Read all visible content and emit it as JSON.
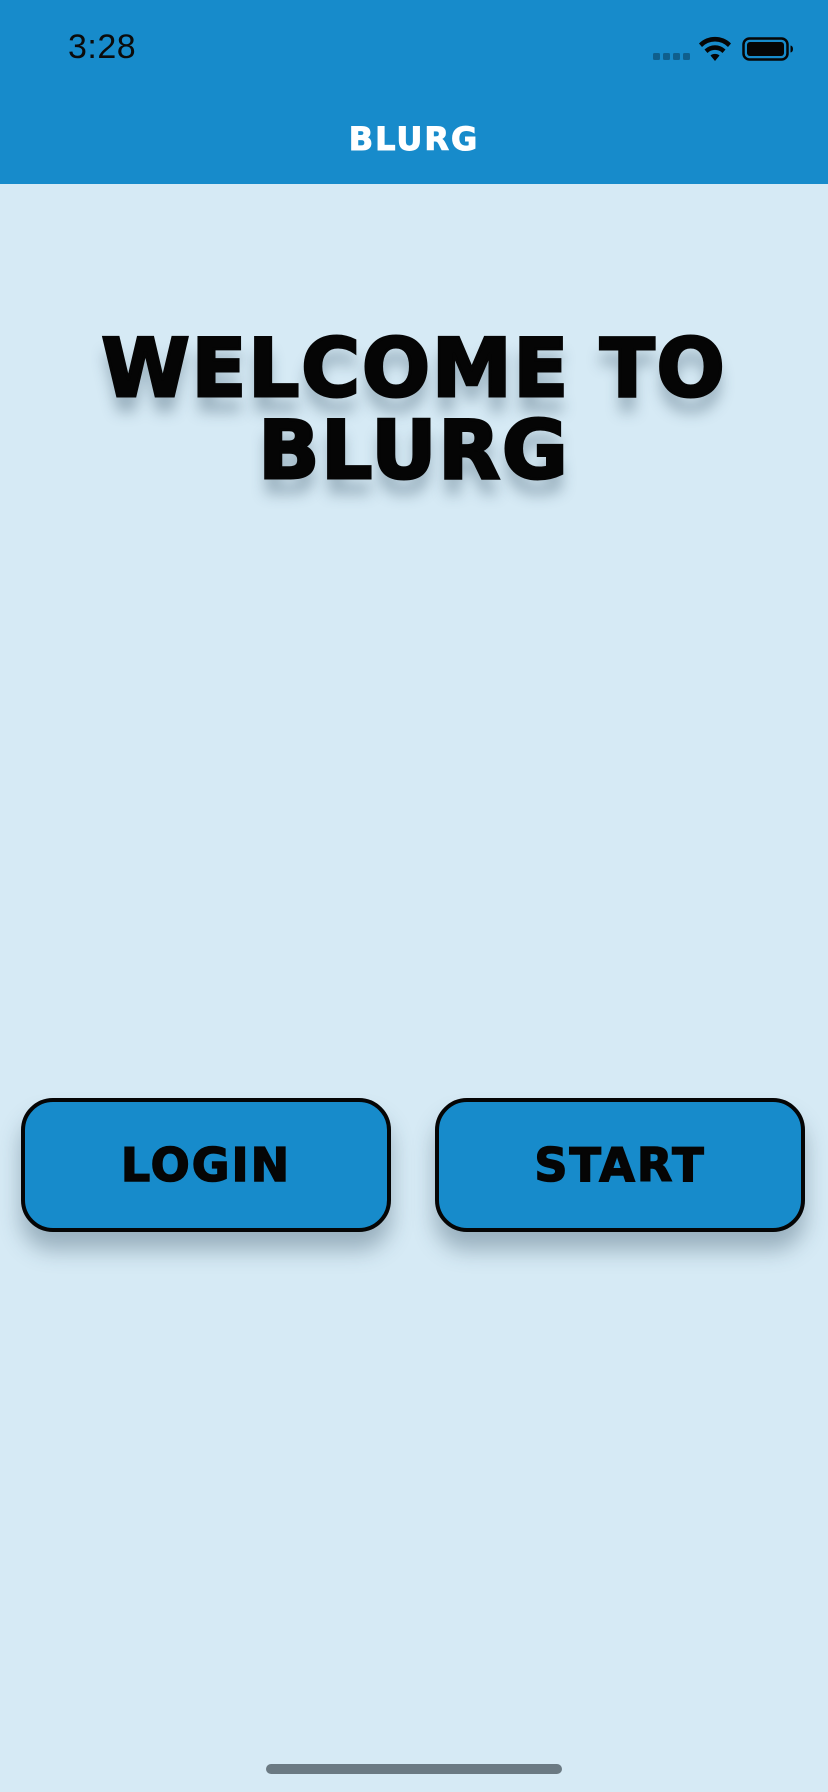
{
  "status_bar": {
    "time": "3:28",
    "icons": [
      "cellular-signal-icon",
      "wifi-icon",
      "battery-icon"
    ]
  },
  "nav": {
    "title": "BLURG"
  },
  "main": {
    "welcome_line1": "WELCOME TO",
    "welcome_line2": "BLURG"
  },
  "actions": {
    "login_label": "LOGIN",
    "start_label": "START"
  },
  "colors": {
    "header_bg": "#178bcb",
    "page_bg": "#d6eaf5",
    "button_bg": "#178bcb",
    "text_dark": "#050505",
    "nav_text": "#ffffff"
  }
}
